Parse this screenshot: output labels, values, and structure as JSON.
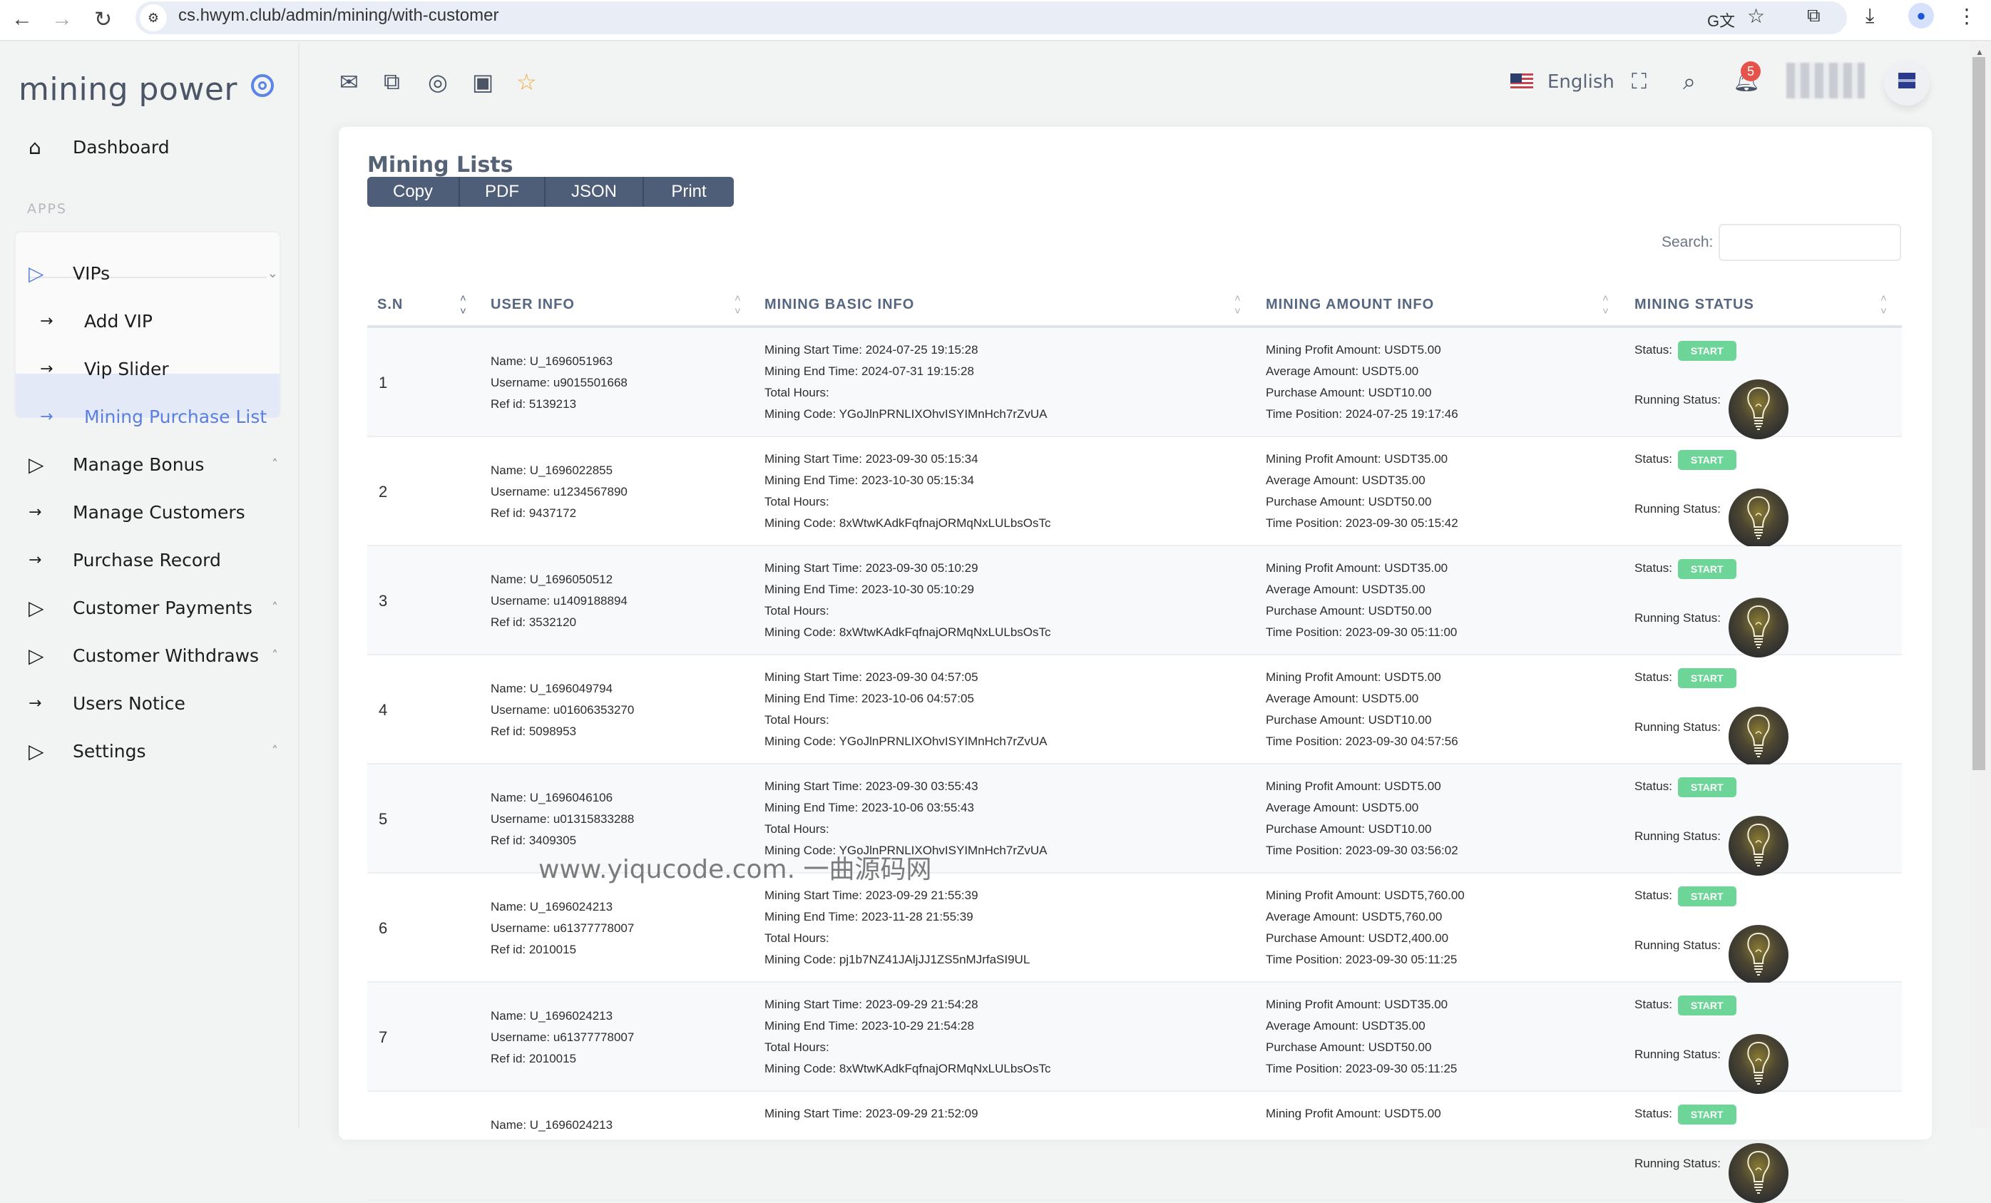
{
  "browser": {
    "url": "cs.hwym.club/admin/mining/with-customer",
    "icons": [
      "back-icon",
      "forward-icon",
      "reload-icon",
      "site-info-icon",
      "translate-icon",
      "bookmark-star-icon",
      "extensions-icon",
      "download-icon",
      "profile-icon",
      "menu-icon"
    ]
  },
  "sidebar": {
    "brand": "mining power",
    "dashboard": "Dashboard",
    "apps_label": "APPS",
    "groups": [
      {
        "label": "VIPs",
        "expanded": true,
        "children": [
          "Add VIP",
          "Vip Slider",
          "Mining Purchase List"
        ],
        "active_child": "Mining Purchase List"
      },
      {
        "label": "Manage Bonus"
      },
      {
        "label": "Manage Customers"
      },
      {
        "label": "Purchase Record"
      },
      {
        "label": "Customer Payments"
      },
      {
        "label": "Customer Withdraws"
      },
      {
        "label": "Users Notice"
      },
      {
        "label": "Settings"
      }
    ]
  },
  "header": {
    "language": "English",
    "notification_count": "5"
  },
  "main": {
    "title": "Mining Lists",
    "export_buttons": [
      "Copy",
      "PDF",
      "JSON",
      "Print"
    ],
    "search_label": "Search:",
    "search_value": "",
    "columns": [
      "S.N",
      "USER INFO",
      "MINING BASIC INFO",
      "MINING AMOUNT INFO",
      "MINING STATUS"
    ],
    "status_label": "Status:",
    "running_label": "Running Status:",
    "status_value": "START",
    "rows": [
      {
        "sn": "1",
        "name": "Name: U_1696051963",
        "username": "Username: u9015501668",
        "ref": "Ref id: 5139213",
        "start": "Mining Start Time: 2024-07-25 19:15:28",
        "end": "Mining End Time: 2024-07-31 19:15:28",
        "hours": "Total Hours:",
        "code": "Mining Code: YGoJlnPRNLIXOhvISYIMnHch7rZvUA",
        "profit": "Mining Profit Amount: USDT5.00",
        "avg": "Average Amount: USDT5.00",
        "purchase": "Purchase Amount: USDT10.00",
        "time": "Time Position: 2024-07-25 19:17:46"
      },
      {
        "sn": "2",
        "name": "Name: U_1696022855",
        "username": "Username: u1234567890",
        "ref": "Ref id: 9437172",
        "start": "Mining Start Time: 2023-09-30 05:15:34",
        "end": "Mining End Time: 2023-10-30 05:15:34",
        "hours": "Total Hours:",
        "code": "Mining Code: 8xWtwKAdkFqfnajORMqNxLULbsOsTc",
        "profit": "Mining Profit Amount: USDT35.00",
        "avg": "Average Amount: USDT35.00",
        "purchase": "Purchase Amount: USDT50.00",
        "time": "Time Position: 2023-09-30 05:15:42"
      },
      {
        "sn": "3",
        "name": "Name: U_1696050512",
        "username": "Username: u1409188894",
        "ref": "Ref id: 3532120",
        "start": "Mining Start Time: 2023-09-30 05:10:29",
        "end": "Mining End Time: 2023-10-30 05:10:29",
        "hours": "Total Hours:",
        "code": "Mining Code: 8xWtwKAdkFqfnajORMqNxLULbsOsTc",
        "profit": "Mining Profit Amount: USDT35.00",
        "avg": "Average Amount: USDT35.00",
        "purchase": "Purchase Amount: USDT50.00",
        "time": "Time Position: 2023-09-30 05:11:00"
      },
      {
        "sn": "4",
        "name": "Name: U_1696049794",
        "username": "Username: u01606353270",
        "ref": "Ref id: 5098953",
        "start": "Mining Start Time: 2023-09-30 04:57:05",
        "end": "Mining End Time: 2023-10-06 04:57:05",
        "hours": "Total Hours:",
        "code": "Mining Code: YGoJlnPRNLIXOhvISYIMnHch7rZvUA",
        "profit": "Mining Profit Amount: USDT5.00",
        "avg": "Average Amount: USDT5.00",
        "purchase": "Purchase Amount: USDT10.00",
        "time": "Time Position: 2023-09-30 04:57:56"
      },
      {
        "sn": "5",
        "name": "Name: U_1696046106",
        "username": "Username: u01315833288",
        "ref": "Ref id: 3409305",
        "start": "Mining Start Time: 2023-09-30 03:55:43",
        "end": "Mining End Time: 2023-10-06 03:55:43",
        "hours": "Total Hours:",
        "code": "Mining Code: YGoJlnPRNLIXOhvISYIMnHch7rZvUA",
        "profit": "Mining Profit Amount: USDT5.00",
        "avg": "Average Amount: USDT5.00",
        "purchase": "Purchase Amount: USDT10.00",
        "time": "Time Position: 2023-09-30 03:56:02"
      },
      {
        "sn": "6",
        "name": "Name: U_1696024213",
        "username": "Username: u61377778007",
        "ref": "Ref id: 2010015",
        "start": "Mining Start Time: 2023-09-29 21:55:39",
        "end": "Mining End Time: 2023-11-28 21:55:39",
        "hours": "Total Hours:",
        "code": "Mining Code: pj1b7NZ41JAljJJ1ZS5nMJrfaSI9UL",
        "profit": "Mining Profit Amount: USDT5,760.00",
        "avg": "Average Amount: USDT5,760.00",
        "purchase": "Purchase Amount: USDT2,400.00",
        "time": "Time Position: 2023-09-30 05:11:25"
      },
      {
        "sn": "7",
        "name": "Name: U_1696024213",
        "username": "Username: u61377778007",
        "ref": "Ref id: 2010015",
        "start": "Mining Start Time: 2023-09-29 21:54:28",
        "end": "Mining End Time: 2023-10-29 21:54:28",
        "hours": "Total Hours:",
        "code": "Mining Code: 8xWtwKAdkFqfnajORMqNxLULbsOsTc",
        "profit": "Mining Profit Amount: USDT35.00",
        "avg": "Average Amount: USDT35.00",
        "purchase": "Purchase Amount: USDT50.00",
        "time": "Time Position: 2023-09-30 05:11:25"
      },
      {
        "sn": "",
        "name": "Name: U_1696024213",
        "username": "",
        "ref": "",
        "start": "Mining Start Time: 2023-09-29 21:52:09",
        "end": "",
        "hours": "",
        "code": "",
        "profit": "Mining Profit Amount: USDT5.00",
        "avg": "",
        "purchase": "",
        "time": ""
      }
    ]
  },
  "watermark": "www.yiqucode.com. 一曲源码网"
}
